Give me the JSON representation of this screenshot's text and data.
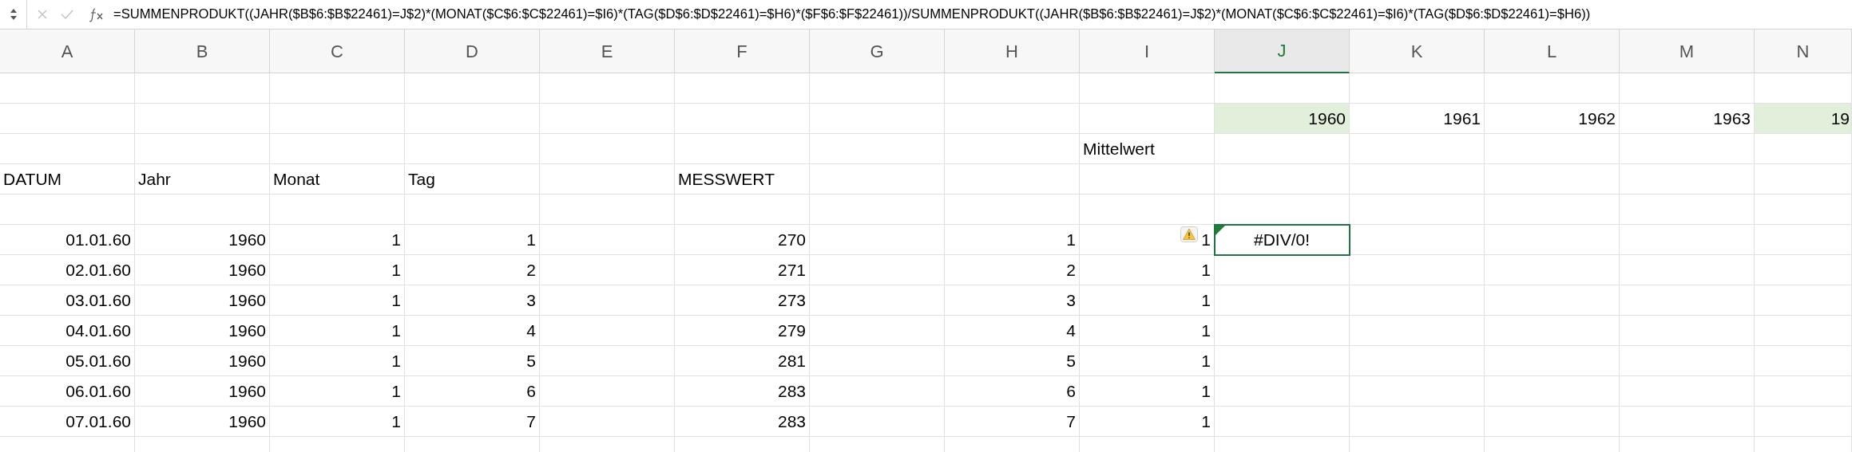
{
  "formula_bar": {
    "formula": "=SUMMENPRODUKT((JAHR($B$6:$B$22461)=J$2)*(MONAT($C$6:$C$22461)=$I6)*(TAG($D$6:$D$22461)=$H6)*($F$6:$F$22461))/SUMMENPRODUKT((JAHR($B$6:$B$22461)=J$2)*(MONAT($C$6:$C$22461)=$I6)*(TAG($D$6:$D$22461)=$H6))"
  },
  "columns": [
    {
      "label": "A",
      "selected": false
    },
    {
      "label": "B",
      "selected": false
    },
    {
      "label": "C",
      "selected": false
    },
    {
      "label": "D",
      "selected": false
    },
    {
      "label": "E",
      "selected": false
    },
    {
      "label": "F",
      "selected": false
    },
    {
      "label": "G",
      "selected": false
    },
    {
      "label": "H",
      "selected": false
    },
    {
      "label": "I",
      "selected": false
    },
    {
      "label": "J",
      "selected": true
    },
    {
      "label": "K",
      "selected": false
    },
    {
      "label": "L",
      "selected": false
    },
    {
      "label": "M",
      "selected": false
    },
    {
      "label": "N",
      "selected": false
    }
  ],
  "rows": [
    {
      "cells": {}
    },
    {
      "cells": {
        "J": {
          "text": "1960",
          "kind": "number",
          "highlighted": true
        },
        "K": {
          "text": "1961",
          "kind": "number",
          "highlighted": false
        },
        "L": {
          "text": "1962",
          "kind": "number",
          "highlighted": false
        },
        "M": {
          "text": "1963",
          "kind": "number",
          "highlighted": false
        },
        "N": {
          "text": "19",
          "kind": "cut",
          "highlighted": true
        }
      }
    },
    {
      "cells": {
        "I": {
          "text": "Mittelwert",
          "kind": "label"
        }
      }
    },
    {
      "cells": {
        "A": {
          "text": "DATUM",
          "kind": "label"
        },
        "B": {
          "text": "Jahr",
          "kind": "label"
        },
        "C": {
          "text": "Monat",
          "kind": "label"
        },
        "D": {
          "text": "Tag",
          "kind": "label"
        },
        "F": {
          "text": "MESSWERT",
          "kind": "label"
        }
      }
    },
    {
      "cells": {}
    },
    {
      "cells": {
        "A": {
          "text": "01.01.60",
          "kind": "number"
        },
        "B": {
          "text": "1960",
          "kind": "number"
        },
        "C": {
          "text": "1",
          "kind": "number"
        },
        "D": {
          "text": "1",
          "kind": "number"
        },
        "F": {
          "text": "270",
          "kind": "number"
        },
        "H": {
          "text": "1",
          "kind": "number"
        },
        "I": {
          "text": "1",
          "kind": "number",
          "warning": true
        },
        "J": {
          "text": "#DIV/0!",
          "kind": "error",
          "selected": true
        }
      }
    },
    {
      "cells": {
        "A": {
          "text": "02.01.60",
          "kind": "number"
        },
        "B": {
          "text": "1960",
          "kind": "number"
        },
        "C": {
          "text": "1",
          "kind": "number"
        },
        "D": {
          "text": "2",
          "kind": "number"
        },
        "F": {
          "text": "271",
          "kind": "number"
        },
        "H": {
          "text": "2",
          "kind": "number"
        },
        "I": {
          "text": "1",
          "kind": "number"
        }
      }
    },
    {
      "cells": {
        "A": {
          "text": "03.01.60",
          "kind": "number"
        },
        "B": {
          "text": "1960",
          "kind": "number"
        },
        "C": {
          "text": "1",
          "kind": "number"
        },
        "D": {
          "text": "3",
          "kind": "number"
        },
        "F": {
          "text": "273",
          "kind": "number"
        },
        "H": {
          "text": "3",
          "kind": "number"
        },
        "I": {
          "text": "1",
          "kind": "number"
        }
      }
    },
    {
      "cells": {
        "A": {
          "text": "04.01.60",
          "kind": "number"
        },
        "B": {
          "text": "1960",
          "kind": "number"
        },
        "C": {
          "text": "1",
          "kind": "number"
        },
        "D": {
          "text": "4",
          "kind": "number"
        },
        "F": {
          "text": "279",
          "kind": "number"
        },
        "H": {
          "text": "4",
          "kind": "number"
        },
        "I": {
          "text": "1",
          "kind": "number"
        }
      }
    },
    {
      "cells": {
        "A": {
          "text": "05.01.60",
          "kind": "number"
        },
        "B": {
          "text": "1960",
          "kind": "number"
        },
        "C": {
          "text": "1",
          "kind": "number"
        },
        "D": {
          "text": "5",
          "kind": "number"
        },
        "F": {
          "text": "281",
          "kind": "number"
        },
        "H": {
          "text": "5",
          "kind": "number"
        },
        "I": {
          "text": "1",
          "kind": "number"
        }
      }
    },
    {
      "cells": {
        "A": {
          "text": "06.01.60",
          "kind": "number"
        },
        "B": {
          "text": "1960",
          "kind": "number"
        },
        "C": {
          "text": "1",
          "kind": "number"
        },
        "D": {
          "text": "6",
          "kind": "number"
        },
        "F": {
          "text": "283",
          "kind": "number"
        },
        "H": {
          "text": "6",
          "kind": "number"
        },
        "I": {
          "text": "1",
          "kind": "number"
        }
      }
    },
    {
      "cells": {
        "A": {
          "text": "07.01.60",
          "kind": "number"
        },
        "B": {
          "text": "1960",
          "kind": "number"
        },
        "C": {
          "text": "1",
          "kind": "number"
        },
        "D": {
          "text": "7",
          "kind": "number"
        },
        "F": {
          "text": "283",
          "kind": "number"
        },
        "H": {
          "text": "7",
          "kind": "number"
        },
        "I": {
          "text": "1",
          "kind": "number"
        }
      }
    },
    {
      "cells": {}
    }
  ]
}
